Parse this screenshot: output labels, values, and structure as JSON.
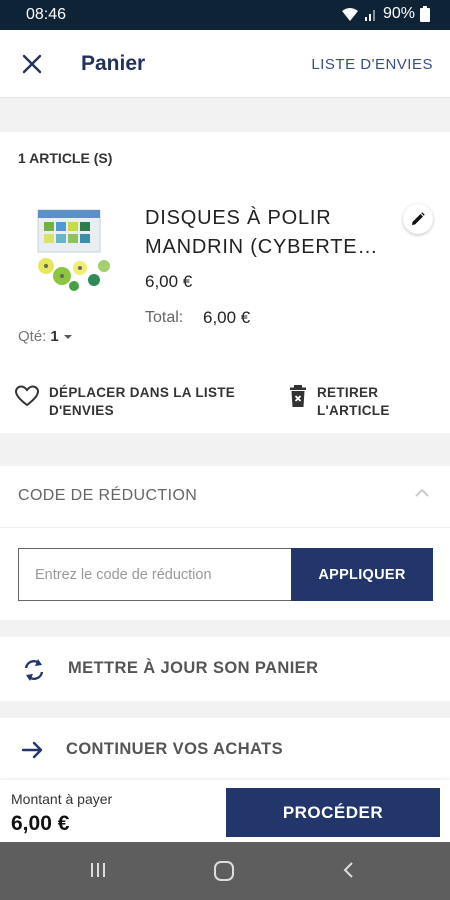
{
  "status_bar": {
    "time": "08:46",
    "battery": "90%"
  },
  "header": {
    "title": "Panier",
    "wishlist_link": "LISTE D'ENVIES"
  },
  "cart": {
    "count_label": "1 ARTICLE (S)"
  },
  "product": {
    "name_line1": "DISQUES À POLIR",
    "name_line2": "MANDRIN (CYBERTE…",
    "price": "6,00 €",
    "total_label": "Total:",
    "total_value": "6,00 €",
    "qty_label": "Qté:",
    "qty_value": "1"
  },
  "actions": {
    "move_line1": "DÉPLACER DANS LA LISTE",
    "move_line2": "D'ENVIES",
    "remove_line1": "RETIRER",
    "remove_line2": "L'ARTICLE"
  },
  "discount": {
    "heading": "CODE DE RÉDUCTION",
    "placeholder": "Entrez le code de réduction",
    "apply_label": "APPLIQUER"
  },
  "links": {
    "update_cart": "METTRE À JOUR SON PANIER",
    "continue_shopping": "CONTINUER VOS ACHATS"
  },
  "footer": {
    "amount_label": "Montant à payer",
    "amount_value": "6,00 €",
    "proceed_label": "PROCÉDER"
  },
  "colors": {
    "brand": "#22366b",
    "status_bar": "#0f2337",
    "nav_bar": "#5e5e5e"
  }
}
